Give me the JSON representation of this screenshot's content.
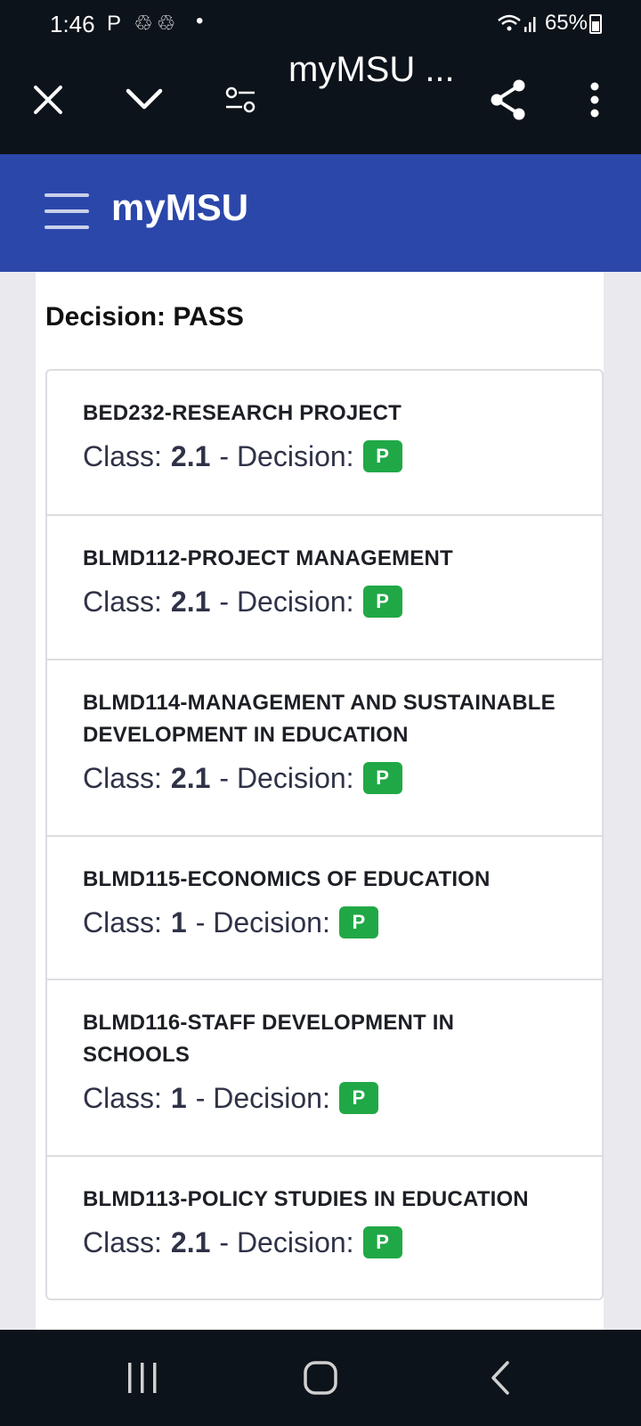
{
  "status_bar": {
    "time": "1:46",
    "left_icons": "P ♲♲",
    "dot": "•",
    "signal_icons": "📶",
    "battery": "65%"
  },
  "browser": {
    "title": "myMSU ...",
    "icons": [
      "close-icon",
      "chevron-down-icon",
      "settings-sliders-icon",
      "share-icon",
      "more-vertical-icon"
    ]
  },
  "app_header": {
    "title": "myMSU"
  },
  "content": {
    "decision_heading": "Decision: PASS",
    "results": [
      {
        "course": "BED232-RESEARCH PROJECT",
        "class_label": "Class:",
        "class_value": "2.1",
        "decision_label": "- Decision:",
        "decision": "P"
      },
      {
        "course": "BLMD112-PROJECT MANAGEMENT",
        "class_label": "Class:",
        "class_value": "2.1",
        "decision_label": "- Decision:",
        "decision": "P"
      },
      {
        "course": "BLMD114-MANAGEMENT AND SUSTAINABLE DEVELOPMENT IN EDUCATION",
        "class_label": "Class:",
        "class_value": "2.1",
        "decision_label": "- Decision:",
        "decision": "P"
      },
      {
        "course": "BLMD115-ECONOMICS OF EDUCATION",
        "class_label": "Class:",
        "class_value": "1",
        "decision_label": "- Decision:",
        "decision": "P"
      },
      {
        "course": "BLMD116-STAFF DEVELOPMENT IN SCHOOLS",
        "class_label": "Class:",
        "class_value": "1",
        "decision_label": "- Decision:",
        "decision": "P"
      },
      {
        "course": "BLMD113-POLICY STUDIES IN EDUCATION",
        "class_label": "Class:",
        "class_value": "2.1",
        "decision_label": "- Decision:",
        "decision": "P"
      }
    ]
  },
  "colors": {
    "header": "#2b47aa",
    "badge_pass": "#21a846",
    "chrome": "#0d131a"
  }
}
